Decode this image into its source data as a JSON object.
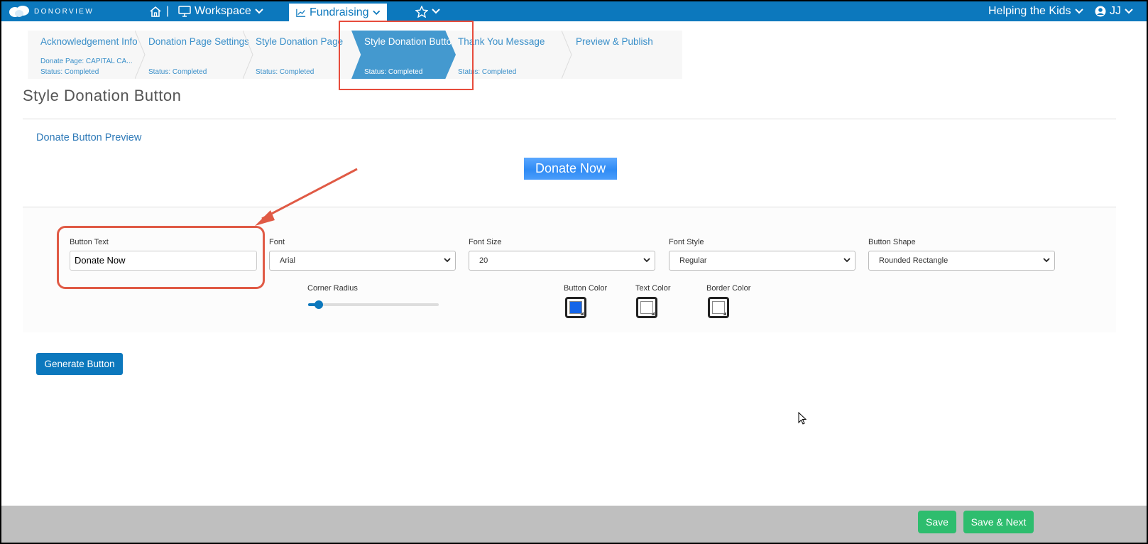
{
  "brand": {
    "name": "DONORVIEW"
  },
  "nav": {
    "workspace": "Workspace",
    "separator": "|",
    "fundraising": "Fundraising",
    "org": "Helping the Kids",
    "user": "JJ"
  },
  "steps": [
    {
      "title": "Acknowledgement Info",
      "detail": "Donate Page: CAPITAL CA...",
      "status": "Status: Completed"
    },
    {
      "title": "Donation Page Settings",
      "status": "Status: Completed"
    },
    {
      "title": "Style Donation Page",
      "status": "Status: Completed"
    },
    {
      "title": "Style Donation Button",
      "status": "Status: Completed"
    },
    {
      "title": "Thank You Message",
      "status": "Status: Completed"
    },
    {
      "title": "Preview & Publish"
    }
  ],
  "page": {
    "title": "Style Donation Button"
  },
  "preview": {
    "title": "Donate Button Preview",
    "button_text": "Donate Now"
  },
  "form": {
    "button_text": {
      "label": "Button Text",
      "value": "Donate Now"
    },
    "font": {
      "label": "Font",
      "value": "Arial"
    },
    "font_size": {
      "label": "Font Size",
      "value": "20"
    },
    "font_style": {
      "label": "Font Style",
      "value": "Regular"
    },
    "button_shape": {
      "label": "Button Shape",
      "value": "Rounded Rectangle"
    },
    "corner_radius": {
      "label": "Corner Radius",
      "level": 0.05
    },
    "button_color": {
      "label": "Button Color",
      "color": "#1565e8"
    },
    "text_color": {
      "label": "Text Color",
      "color": "#ffffff"
    },
    "border_color": {
      "label": "Border Color",
      "color": "#ffffff"
    }
  },
  "actions": {
    "generate": "Generate Button",
    "save": "Save",
    "save_next": "Save & Next"
  },
  "colors": {
    "nav": "#0c78bd",
    "active_step": "#4499cf",
    "success": "#2ebd6e",
    "callout": "#e05a45"
  }
}
